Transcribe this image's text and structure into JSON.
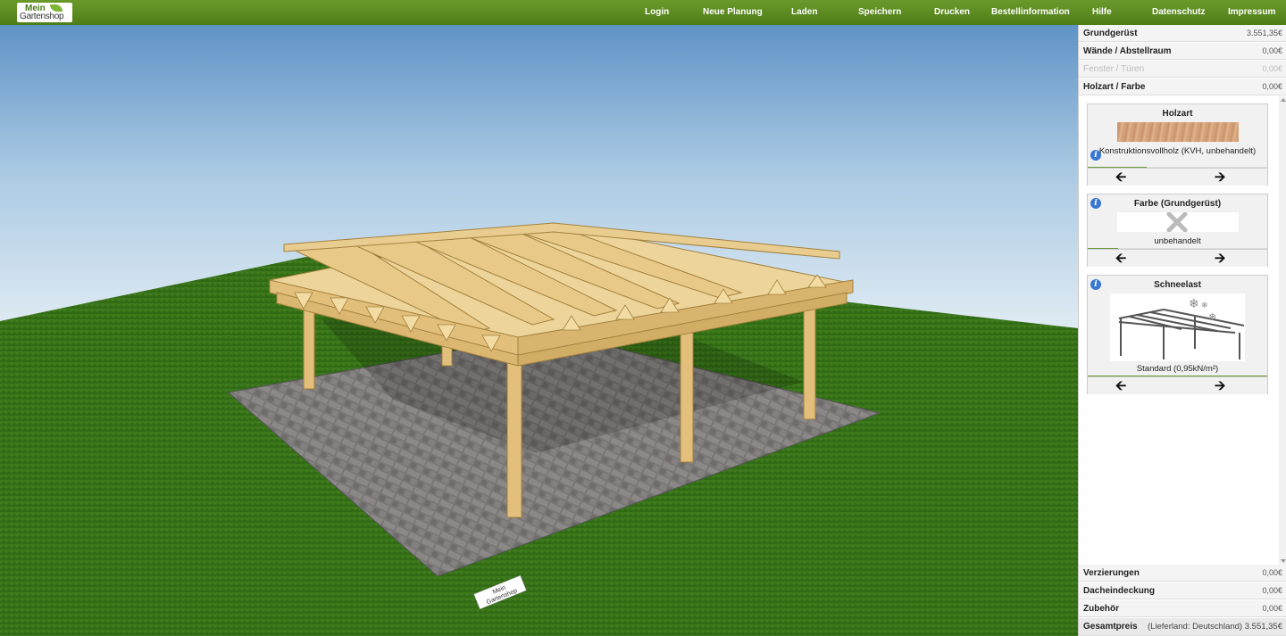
{
  "logo": {
    "line1": "Mein",
    "line2": "Gartenshop"
  },
  "nav": [
    "Login",
    "Neue Planung",
    "Laden",
    "Speichern",
    "Drucken",
    "Bestellinformation",
    "Hilfe",
    "Datenschutz",
    "Impressum"
  ],
  "scene": {
    "ground_tag_line1": "Mein",
    "ground_tag_line2": "Gartenshop"
  },
  "panel": {
    "sections_top": [
      {
        "label": "Grundgerüst",
        "value": "3.551,35€",
        "enabled": true
      },
      {
        "label": "Wände / Abstellraum",
        "value": "0,00€",
        "enabled": true
      },
      {
        "label": "Fenster / Türen",
        "value": "0,00€",
        "enabled": false
      },
      {
        "label": "Holzart / Farbe",
        "value": "0,00€",
        "enabled": true
      }
    ],
    "cards": [
      {
        "title": "Holzart",
        "text": "Konstruktionsvollholz (KVH, unbehandelt)",
        "progress": 0.33
      },
      {
        "title": "Farbe (Grundgerüst)",
        "text": "unbehandelt",
        "progress": 0.17
      },
      {
        "title": "Schneelast",
        "text": "Standard (0,95kN/m²)",
        "progress": 1.0
      }
    ],
    "sections_bottom": [
      {
        "label": "Verzierungen",
        "value": "0,00€"
      },
      {
        "label": "Dacheindeckung",
        "value": "0,00€"
      },
      {
        "label": "Zubehör",
        "value": "0,00€"
      }
    ],
    "total": {
      "label": "Gesamtpreis",
      "value": "(Lieferland: Deutschland) 3.551,35€"
    }
  },
  "colors": {
    "topbar": "#5a8a20",
    "accent": "#6a9a3a",
    "info": "#3a78d0"
  }
}
